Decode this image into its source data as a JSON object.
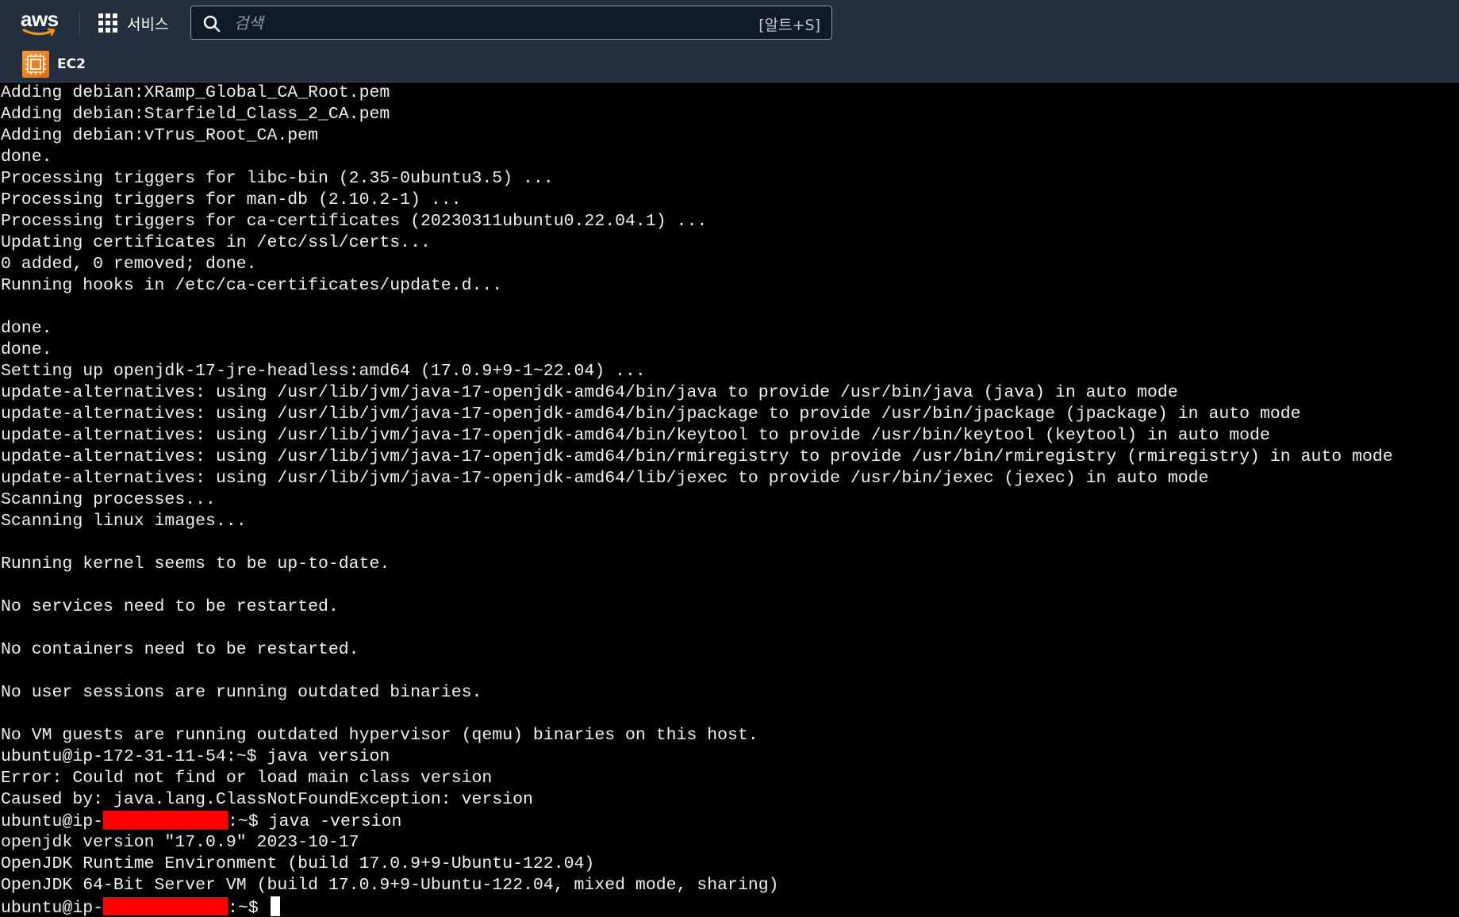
{
  "topbar": {
    "logo_text": "aws",
    "services_label": "서비스",
    "search_placeholder": "검색",
    "search_shortcut": "[알트+S]"
  },
  "subbar": {
    "service_name": "EC2"
  },
  "colors": {
    "nav_bg": "#232f3e",
    "terminal_bg": "#000000",
    "terminal_fg": "#f0f0f0",
    "redaction": "#ff0000",
    "ec2_orange": "#e36b0a"
  },
  "icons": {
    "logo": "aws-logo-icon",
    "services": "grid-icon",
    "search": "search-icon",
    "ec2": "ec2-icon"
  },
  "terminal": {
    "lines": [
      "Adding debian:XRamp_Global_CA_Root.pem",
      "Adding debian:Starfield_Class_2_CA.pem",
      "Adding debian:vTrus_Root_CA.pem",
      "done.",
      "Processing triggers for libc-bin (2.35-0ubuntu3.5) ...",
      "Processing triggers for man-db (2.10.2-1) ...",
      "Processing triggers for ca-certificates (20230311ubuntu0.22.04.1) ...",
      "Updating certificates in /etc/ssl/certs...",
      "0 added, 0 removed; done.",
      "Running hooks in /etc/ca-certificates/update.d...",
      "",
      "done.",
      "done.",
      "Setting up openjdk-17-jre-headless:amd64 (17.0.9+9-1~22.04) ...",
      "update-alternatives: using /usr/lib/jvm/java-17-openjdk-amd64/bin/java to provide /usr/bin/java (java) in auto mode",
      "update-alternatives: using /usr/lib/jvm/java-17-openjdk-amd64/bin/jpackage to provide /usr/bin/jpackage (jpackage) in auto mode",
      "update-alternatives: using /usr/lib/jvm/java-17-openjdk-amd64/bin/keytool to provide /usr/bin/keytool (keytool) in auto mode",
      "update-alternatives: using /usr/lib/jvm/java-17-openjdk-amd64/bin/rmiregistry to provide /usr/bin/rmiregistry (rmiregistry) in auto mode",
      "update-alternatives: using /usr/lib/jvm/java-17-openjdk-amd64/lib/jexec to provide /usr/bin/jexec (jexec) in auto mode",
      "Scanning processes...",
      "Scanning linux images...",
      "",
      "Running kernel seems to be up-to-date.",
      "",
      "No services need to be restarted.",
      "",
      "No containers need to be restarted.",
      "",
      "No user sessions are running outdated binaries.",
      "",
      "No VM guests are running outdated hypervisor (qemu) binaries on this host.",
      "ubuntu@ip-172-31-11-54:~$ java version",
      "Error: Could not find or load main class version",
      "Caused by: java.lang.ClassNotFoundException: version"
    ],
    "redacted_prompt_1": {
      "prefix": "ubuntu@ip-",
      "suffix": ":~$ java -version"
    },
    "output_lines": [
      "openjdk version \"17.0.9\" 2023-10-17",
      "OpenJDK Runtime Environment (build 17.0.9+9-Ubuntu-122.04)",
      "OpenJDK 64-Bit Server VM (build 17.0.9+9-Ubuntu-122.04, mixed mode, sharing)"
    ],
    "redacted_prompt_2": {
      "prefix": "ubuntu@ip-",
      "suffix": ":~$ "
    }
  }
}
